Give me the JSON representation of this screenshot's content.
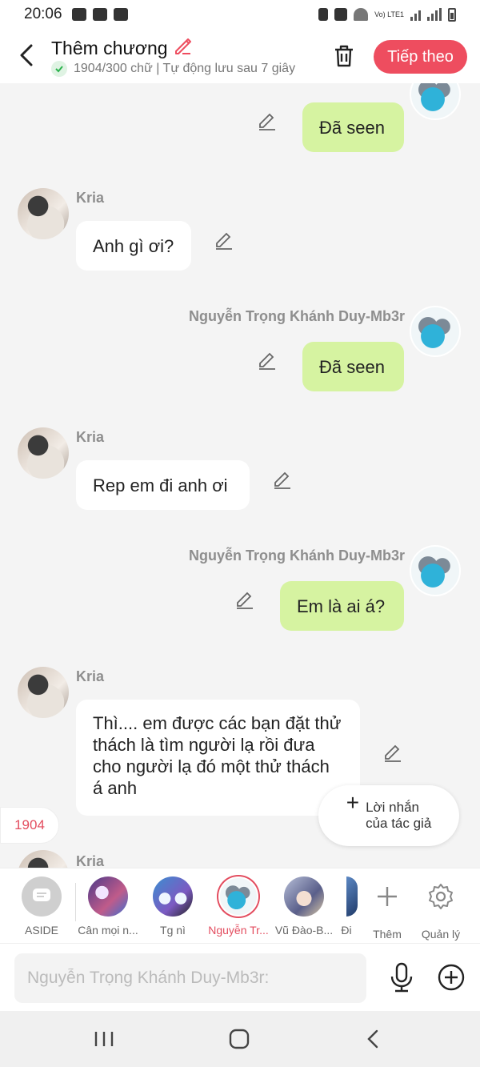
{
  "status_bar": {
    "time": "20:06",
    "network": "Vo) LTE1"
  },
  "header": {
    "title": "Thêm chương",
    "subtitle": "1904/300 chữ | Tự động lưu sau 7 giây",
    "next_label": "Tiếp theo"
  },
  "messages": [
    {
      "side": "out",
      "sender": "",
      "text": "Đã seen"
    },
    {
      "side": "in",
      "sender": "Kria",
      "text": "Anh gì ơi?"
    },
    {
      "side": "out",
      "sender": "Nguyễn Trọng Khánh Duy-Mb3r",
      "text": "Đã seen"
    },
    {
      "side": "in",
      "sender": "Kria",
      "text": "Rep em đi anh ơi"
    },
    {
      "side": "out",
      "sender": "Nguyễn Trọng Khánh Duy-Mb3r",
      "text": "Em là ai á?"
    },
    {
      "side": "in",
      "sender": "Kria",
      "text": "Thì.... em được các bạn đặt thử thách là tìm người lạ rồi đưa cho người lạ đó một thử thách á anh"
    },
    {
      "side": "in",
      "sender": "Kria",
      "text": ""
    }
  ],
  "word_count_badge": "1904",
  "author_note": {
    "line1": "Lời nhắn",
    "line2": "của tác giả"
  },
  "characters": [
    {
      "label": "ASIDE",
      "color": "#cfcfcf"
    },
    {
      "label": "Cân mọi n...",
      "color": "#7a6fd1"
    },
    {
      "label": "Tg nì",
      "color": "#6fb3e6"
    },
    {
      "label": "Nguyễn Tr...",
      "color": "#33b3dc",
      "active": true
    },
    {
      "label": "Vũ Đào-B...",
      "color": "#8a7fb0"
    },
    {
      "label": "Đi",
      "color": "#5c88c4"
    }
  ],
  "actions": {
    "add_label": "Thêm",
    "manage_label": "Quản lý"
  },
  "input": {
    "placeholder": "Nguyễn Trọng Khánh Duy-Mb3r:"
  },
  "colors": {
    "accent": "#ee4d5f",
    "outgoing_bubble": "#d6f3a1",
    "incoming_bubble": "#ffffff"
  }
}
